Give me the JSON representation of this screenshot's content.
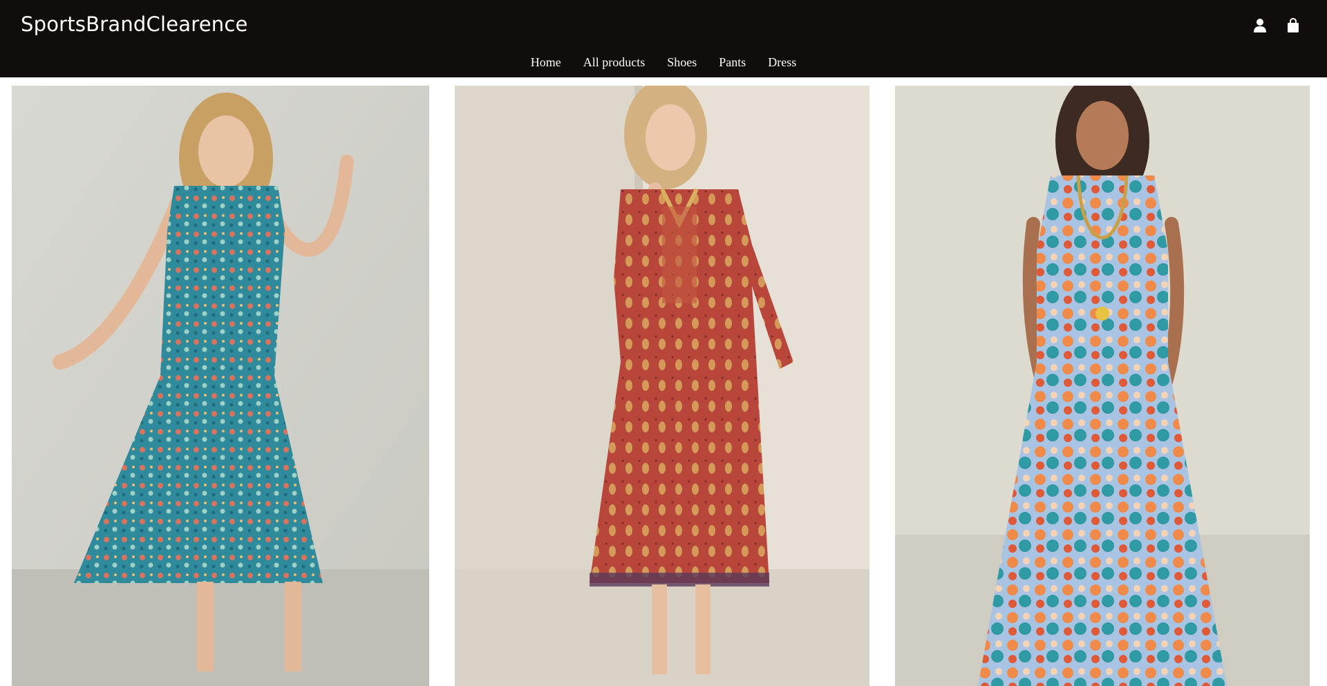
{
  "header": {
    "brand": "SportsBrandClearence",
    "icons": [
      "account-icon",
      "shopping-bag-icon"
    ],
    "background": "#100d0c"
  },
  "nav": {
    "items": [
      {
        "label": "Home"
      },
      {
        "label": "All products"
      },
      {
        "label": "Shoes"
      },
      {
        "label": "Pants"
      },
      {
        "label": "Dress"
      }
    ]
  },
  "products": [
    {
      "image": "woman in blue paisley tiered midi dress"
    },
    {
      "image": "woman in red paisley embroidered tunic dress"
    },
    {
      "image": "woman in multicolor floral maxi dress"
    }
  ]
}
